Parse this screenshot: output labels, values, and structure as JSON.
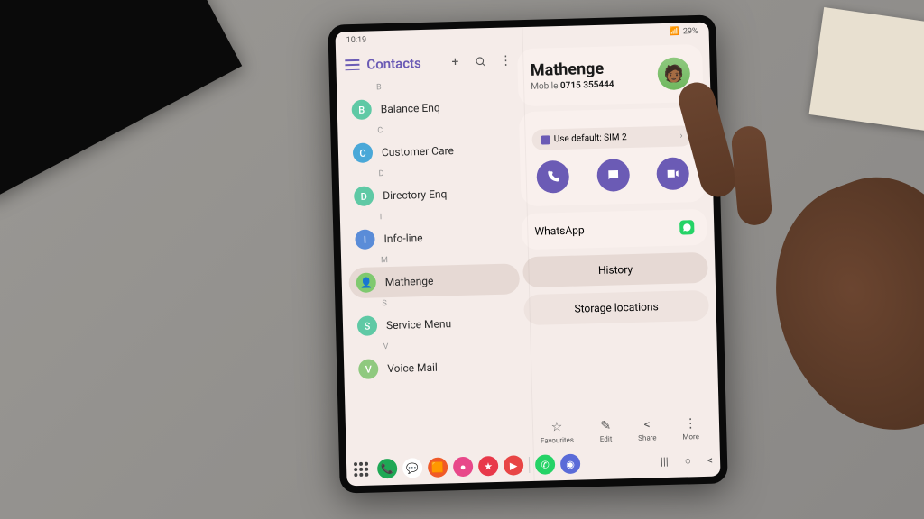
{
  "statusbar": {
    "time": "10:19",
    "battery": "29%"
  },
  "header": {
    "title": "Contacts"
  },
  "sections": [
    {
      "letter": "B",
      "name": "Balance Enq",
      "avatar": "B",
      "color": "#5fc9a5"
    },
    {
      "letter": "C",
      "name": "Customer Care",
      "avatar": "C",
      "color": "#4aa8d8"
    },
    {
      "letter": "D",
      "name": "Directory Enq",
      "avatar": "D",
      "color": "#5fc9a5"
    },
    {
      "letter": "I",
      "name": "Info-line",
      "avatar": "I",
      "color": "#5a8cd8"
    },
    {
      "letter": "M",
      "name": "Mathenge",
      "avatar": "👤",
      "color": "#7fc96f",
      "selected": true
    },
    {
      "letter": "S",
      "name": "Service Menu",
      "avatar": "S",
      "color": "#5fc9a5"
    },
    {
      "letter": "V",
      "name": "Voice Mail",
      "avatar": "V",
      "color": "#8fc97f"
    }
  ],
  "detail": {
    "name": "Mathenge",
    "phone_label": "Mobile",
    "phone": "0715 355444",
    "sim": "Use default: SIM 2",
    "whatsapp": "WhatsApp",
    "history": "History",
    "storage": "Storage locations"
  },
  "bottom": {
    "fav": "Favourites",
    "edit": "Edit",
    "share": "Share",
    "more": "More"
  }
}
